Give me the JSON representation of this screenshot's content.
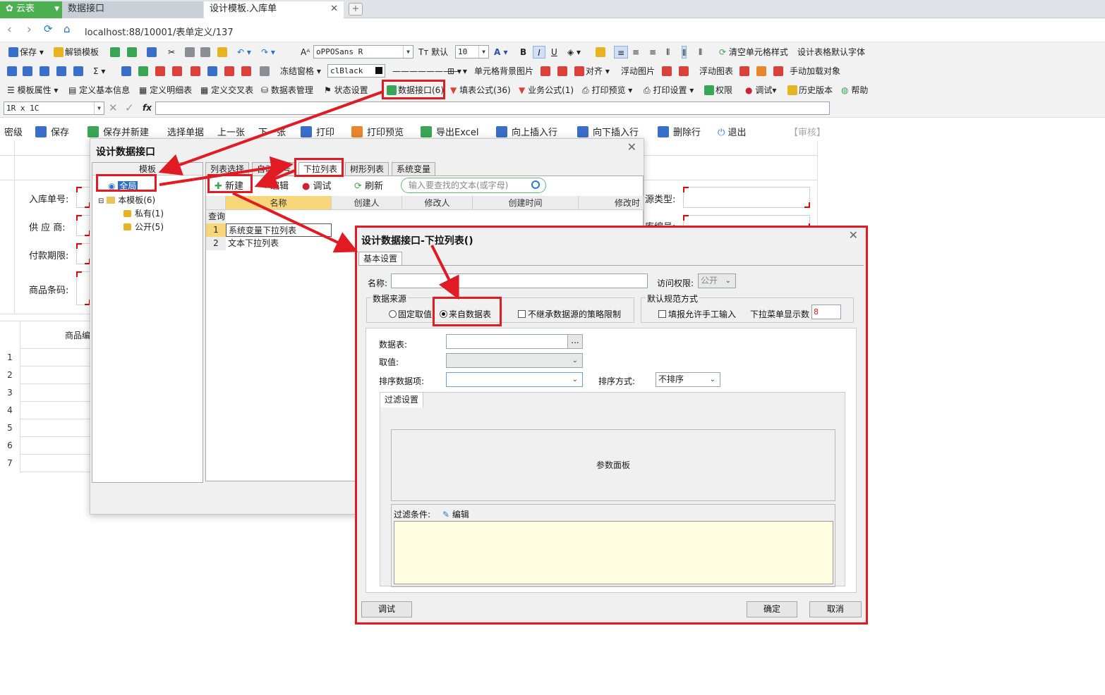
{
  "tabs": {
    "home": "云表",
    "tab1": "数据接口",
    "tab2": "设计模板.入库单"
  },
  "url": "localhost:88/10001/表单定义/137",
  "toolbar1": {
    "save": "保存",
    "unlock": "解锁模板",
    "font": "oPPOSans R",
    "font_default": "默认",
    "font_size": "10",
    "bold": "B",
    "italic": "I",
    "underline": "U",
    "clear_style": "清空单元格样式",
    "default_font": "设计表格默认字体"
  },
  "toolbar2": {
    "sigma": "Σ",
    "freeze": "冻结窗格",
    "color": "clBlack",
    "bg_image": "单元格背景图片",
    "align": "对齐",
    "float_image": "浮动图片",
    "float_chart": "浮动图表",
    "manual_load": "手动加载对象"
  },
  "toolbar3": {
    "template_props": "模板属性",
    "basic_info": "定义基本信息",
    "detail_table": "定义明细表",
    "cross_table": "定义交叉表",
    "table_mgmt": "数据表管理",
    "status": "状态设置",
    "data_interface": "数据接口(6)",
    "fill_formula": "填表公式(36)",
    "biz_formula": "业务公式(1)",
    "print_preview": "打印预览",
    "print_settings": "打印设置",
    "permissions": "权限",
    "debug": "调试",
    "history": "历史版本",
    "help": "帮助"
  },
  "formula_bar": {
    "cell_ref": "1R x 1C",
    "fx": "fx"
  },
  "action_bar": {
    "secret": "密级",
    "save": "保存",
    "save_new": "保存并新建",
    "select": "选择单据",
    "prev": "上一张",
    "next": "下一张",
    "print": "打印",
    "print_preview": "打印预览",
    "export_excel": "导出Excel",
    "insert_up": "向上插入行",
    "insert_down": "向下插入行",
    "delete_row": "删除行",
    "exit": "退出",
    "audit": "【审核】"
  },
  "form": {
    "labels": [
      "入库单号:",
      "供 应 商:",
      "付款期限:",
      "商品条码:"
    ],
    "right_labels": [
      "源类型:",
      "库编号:"
    ],
    "grid_header": "商品编",
    "row_numbers": [
      "1",
      "2",
      "3",
      "4",
      "5",
      "6",
      "7"
    ]
  },
  "dialog1": {
    "title": "设计数据接口",
    "tree_header": "模板",
    "tree": {
      "global": "全局",
      "this_template": "本模板(6)",
      "private": "私有(1)",
      "public": "公开(5)"
    },
    "tabs": [
      "列表选择",
      "自动编号",
      "下拉列表",
      "树形列表",
      "系统变量"
    ],
    "buttons": {
      "new": "新建",
      "edit": "编辑",
      "debug": "调试",
      "refresh": "刷新"
    },
    "search_placeholder": "输入要查找的文本(或字母)",
    "columns": [
      "名称",
      "创建人",
      "修改人",
      "创建时间",
      "修改时"
    ],
    "query_label": "查询",
    "rows": [
      {
        "num": "1",
        "name": "系统变量下拉列表"
      },
      {
        "num": "2",
        "name": "文本下拉列表"
      }
    ]
  },
  "dialog2": {
    "title": "设计数据接口-下拉列表()",
    "tab": "基本设置",
    "name_label": "名称:",
    "access_label": "访问权限:",
    "access_value": "公开",
    "source_group": "数据来源",
    "fixed_value": "固定取值",
    "from_table": "来自数据表",
    "no_inherit": "不继承数据源的策略限制",
    "default_group": "默认规范方式",
    "allow_manual": "填报允许手工输入",
    "dropdown_count_label": "下拉菜单显示数",
    "dropdown_count": "8",
    "table_label": "数据表:",
    "ellipsis": "...",
    "value_label": "取值:",
    "sort_item_label": "排序数据项:",
    "sort_mode_label": "排序方式:",
    "sort_mode": "不排序",
    "filter_tab": "过滤设置",
    "param_panel": "参数面板",
    "filter_cond": "过滤条件:",
    "filter_edit": "编辑",
    "debug_btn": "调试",
    "ok_btn": "确定",
    "cancel_btn": "取消"
  },
  "colors": {
    "annotation": "#e01b24",
    "accent_green": "#4caf50",
    "filter_bg": "#fffde0"
  }
}
